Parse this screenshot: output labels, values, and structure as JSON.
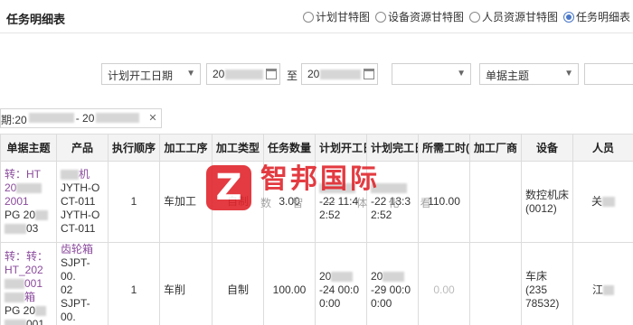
{
  "header": {
    "title": "任务明细表",
    "views": [
      {
        "label": "计划甘特图",
        "checked": false
      },
      {
        "label": "设备资源甘特图",
        "checked": false
      },
      {
        "label": "人员资源甘特图",
        "checked": false
      },
      {
        "label": "任务明细表",
        "checked": true
      }
    ]
  },
  "filters": {
    "date_field": "计划开工日期",
    "date_from_prefix": "20",
    "to_label": "至",
    "date_to_prefix": "20",
    "empty_select": "",
    "document_field": "单据主题",
    "search_value": ""
  },
  "active_tag": {
    "prefix": "期:20",
    "separator": "- 20"
  },
  "table": {
    "columns": [
      "单据主题",
      "产品",
      "执行顺序",
      "加工工序",
      "加工类型",
      "任务数量",
      "计划开工日",
      "计划完工日",
      "所需工时(h",
      "加工厂商",
      "设备",
      "人员"
    ],
    "rows": [
      {
        "doc_l1": "转：HT",
        "doc_l2": "20",
        "doc_l3": "2001",
        "doc_l4": "PG 20",
        "doc_l5": "03",
        "prod_l1": "机",
        "prod_l2": "JYTH-O",
        "prod_l3": "CT-011",
        "prod_l4": "JYTH-O",
        "prod_l5": "CT-011",
        "order": "1",
        "process": "车加工",
        "type": "自制",
        "qty": "3.00",
        "start_l1": "-22 11:4",
        "start_l2": "2:52",
        "end_l1": "-22 13:3",
        "end_l2": "2:52",
        "hours": "110.00",
        "vendor": "",
        "equip_l1": "数控机床",
        "equip_l2": "(0012)",
        "person": "关"
      },
      {
        "doc_l1": "转：转：",
        "doc_l2": "HT_202",
        "doc_l3": "001",
        "doc_l4": "箱",
        "doc_l5": "PG 20",
        "doc_l6": "001",
        "prod_l1": "齿轮箱",
        "prod_l2": "SJPT-00.",
        "prod_l3": "02",
        "prod_l4": "SJPT-00.",
        "prod_l5": "02",
        "order": "1",
        "process": "车削",
        "type": "自制",
        "qty": "100.00",
        "start_l1": "20",
        "start_l2": "-24 00:0",
        "start_l3": "0:00",
        "end_l1": "20",
        "end_l2": "-29 00:0",
        "end_l3": "0:00",
        "hours": "0.00",
        "vendor": "",
        "equip_l1": "车床(235",
        "equip_l2": "78532)",
        "person": "江"
      }
    ]
  },
  "watermark": {
    "logo": "Z",
    "main": "智邦国际",
    "sub": "数 智 一 体 化 看"
  }
}
